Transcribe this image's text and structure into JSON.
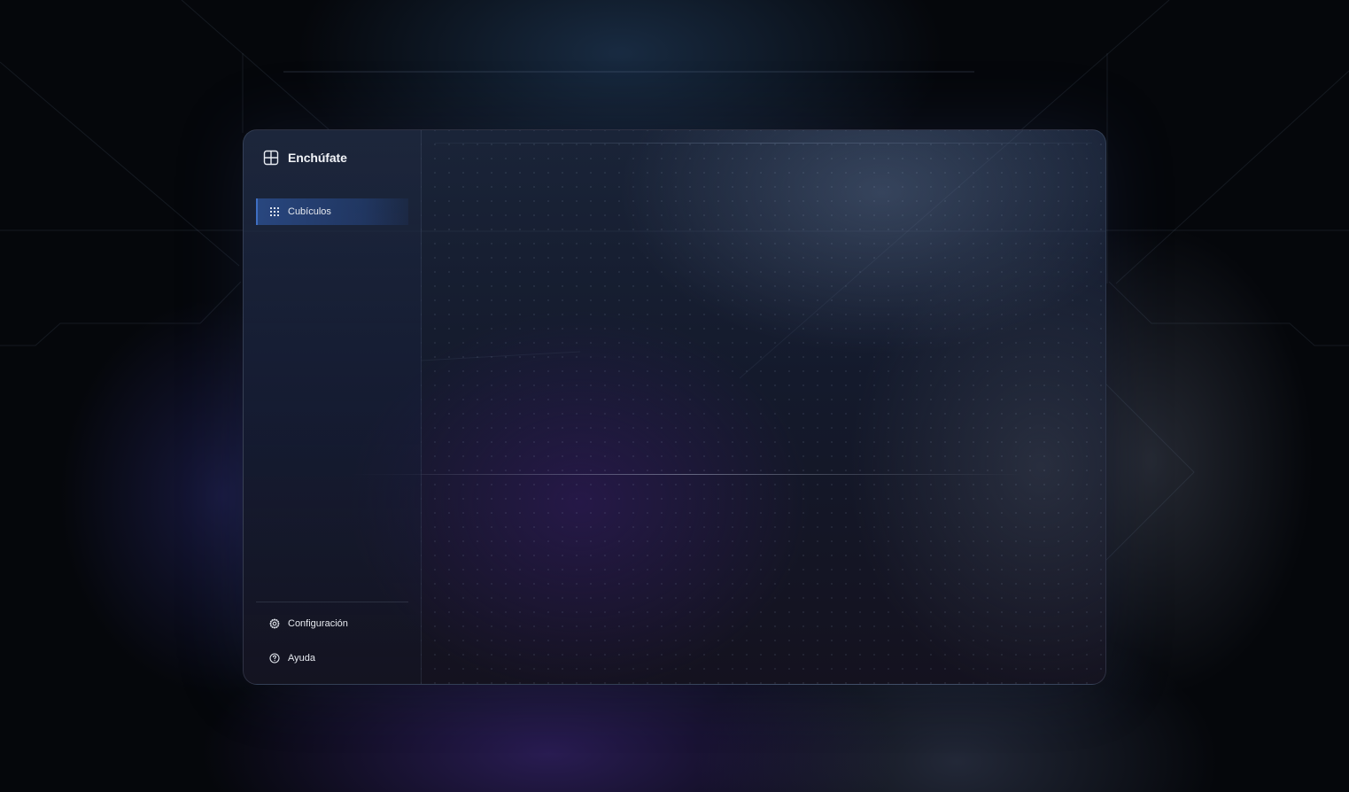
{
  "app": {
    "name": "Enchúfate",
    "logo_icon": "layout-grid-icon"
  },
  "sidebar": {
    "primary": [
      {
        "label": "Cubículos",
        "icon": "grid-dots-icon",
        "active": true
      }
    ],
    "footer": [
      {
        "label": "Configuración",
        "icon": "gear-icon"
      },
      {
        "label": "Ayuda",
        "icon": "help-circle-icon"
      }
    ]
  },
  "colors": {
    "background": "#05070b",
    "active_item": "#2d5296",
    "active_border": "#3f6fc2",
    "text": "#e6e9ef"
  }
}
